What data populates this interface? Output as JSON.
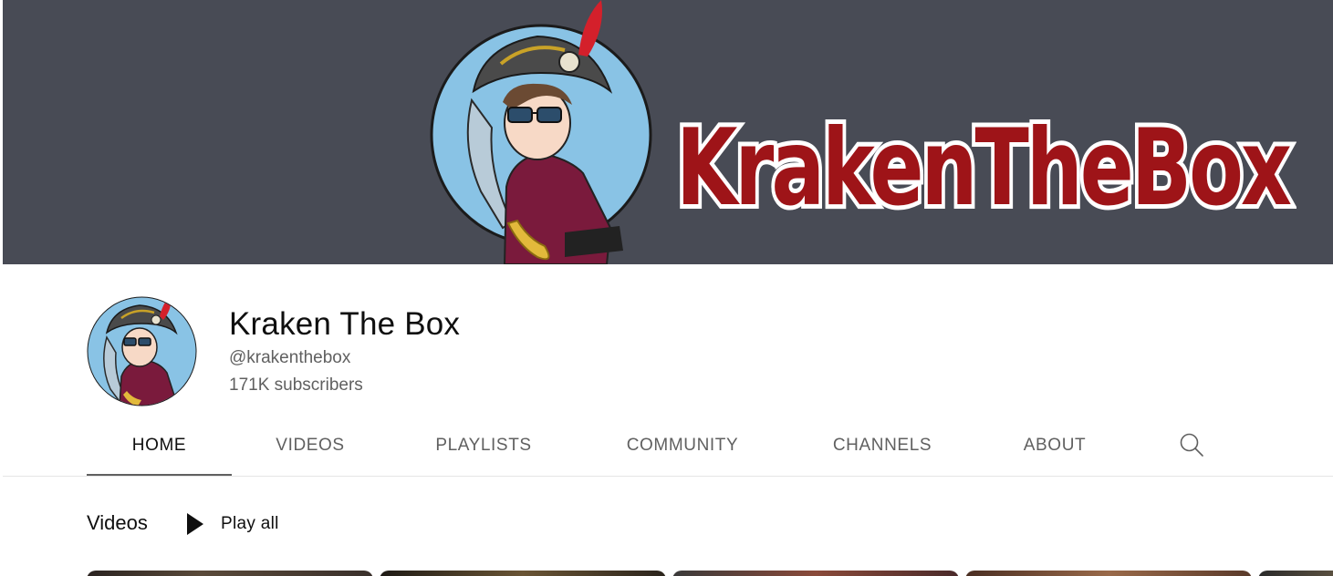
{
  "banner": {
    "logo_text": "KrakenTheBox"
  },
  "channel": {
    "name": "Kraken The Box",
    "handle": "@krakenthebox",
    "subscribers": "171K subscribers"
  },
  "tabs": [
    {
      "label": "HOME",
      "active": true
    },
    {
      "label": "VIDEOS",
      "active": false
    },
    {
      "label": "PLAYLISTS",
      "active": false
    },
    {
      "label": "COMMUNITY",
      "active": false
    },
    {
      "label": "CHANNELS",
      "active": false
    },
    {
      "label": "ABOUT",
      "active": false
    }
  ],
  "search_icon": "search-icon",
  "shelf": {
    "title": "Videos",
    "play_all_label": "Play all",
    "play_icon": "play-icon"
  },
  "colors": {
    "banner_bg": "#484b55",
    "logo_red": "#9e1418",
    "text_primary": "#0f0f0f",
    "text_secondary": "#606060"
  }
}
